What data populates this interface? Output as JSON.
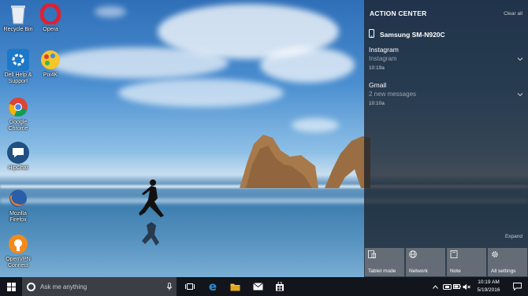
{
  "desktop": {
    "icons": [
      {
        "label": "Recycle Bin",
        "icon": "recycle-bin-icon"
      },
      {
        "label": "Opera",
        "icon": "opera-icon"
      },
      {
        "label": "Dell Help & Support",
        "icon": "dell-support-icon"
      },
      {
        "label": "Pix4K",
        "icon": "pix4k-icon"
      },
      {
        "label": "Google Chrome",
        "icon": "chrome-icon"
      },
      {
        "label": "HipChat",
        "icon": "hipchat-icon"
      },
      {
        "label": "Mozilla Firefox",
        "icon": "firefox-icon"
      },
      {
        "label": "OpenVPN Connect",
        "icon": "openvpn-icon"
      }
    ]
  },
  "action_center": {
    "title": "ACTION CENTER",
    "clear_all": "Clear all",
    "device": {
      "name": "Samsung SM-N920C",
      "icon": "phone-icon"
    },
    "notifications": [
      {
        "app": "Instagram",
        "body": "Instagram",
        "time": "10:19a"
      },
      {
        "app": "Gmail",
        "body": "2 new messages",
        "time": "10:10a"
      }
    ],
    "expand": "Expand",
    "quick_actions": [
      {
        "label": "Tablet mode",
        "icon": "tablet-mode-icon"
      },
      {
        "label": "Network",
        "icon": "network-globe-icon"
      },
      {
        "label": "Note",
        "icon": "note-icon"
      },
      {
        "label": "All settings",
        "icon": "gear-icon"
      }
    ]
  },
  "taskbar": {
    "search_placeholder": "Ask me anything",
    "apps": [
      "task-view-icon",
      "edge-icon",
      "file-explorer-icon",
      "mail-icon",
      "store-icon"
    ],
    "clock": {
      "time": "10:19 AM",
      "date": "5/19/2016"
    }
  },
  "colors": {
    "accent_chrome_red": "#db4437",
    "opera_red": "#e0202f",
    "edge_blue": "#2b8dd8",
    "folder_yellow": "#f2c13b",
    "action_center_bg": "#1c222c",
    "tile_bg": "#6e747e"
  }
}
